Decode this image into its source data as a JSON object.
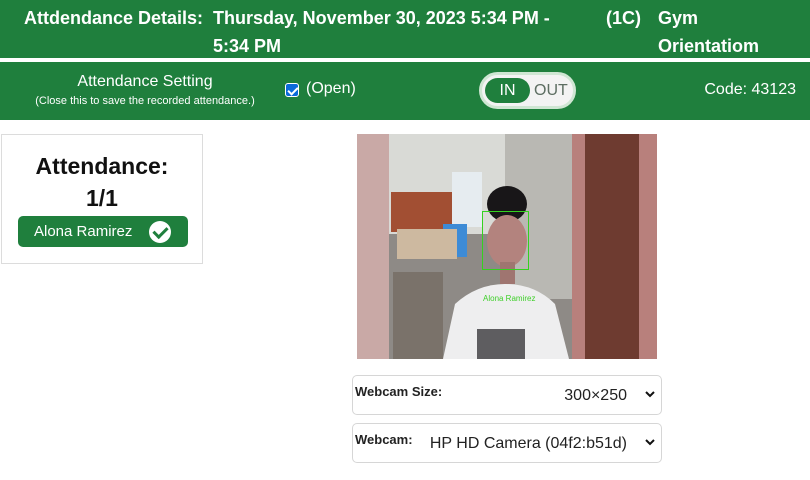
{
  "header": {
    "label": "Attdendance Details:",
    "datetime": "Thursday, November 30, 2023 5:34 PM - 5:34 PM",
    "section": "(1C)",
    "subject": "Gym Orientatiom"
  },
  "settings": {
    "title": "Attendance Setting",
    "subtitle": "(Close this to save the recorded attendance.)",
    "checkbox_checked": true,
    "open_label": "(Open)",
    "toggle_in": "IN",
    "toggle_out": "OUT",
    "code_label": "Code: 43123"
  },
  "attendance": {
    "title": "Attendance:",
    "count": "1/1",
    "students": [
      {
        "name": "Alona Ramirez",
        "status_icon": "check-circle-icon"
      }
    ]
  },
  "webcam": {
    "detected_label": "Alona Ramirez"
  },
  "controls": {
    "size_label": "Webcam Size:",
    "size_value": "300×250",
    "camera_label": "Webcam:",
    "camera_value": "HP HD Camera (04f2:b51d)"
  },
  "colors": {
    "primary_green": "#1f7f3d",
    "detection_green": "#34d11f"
  }
}
